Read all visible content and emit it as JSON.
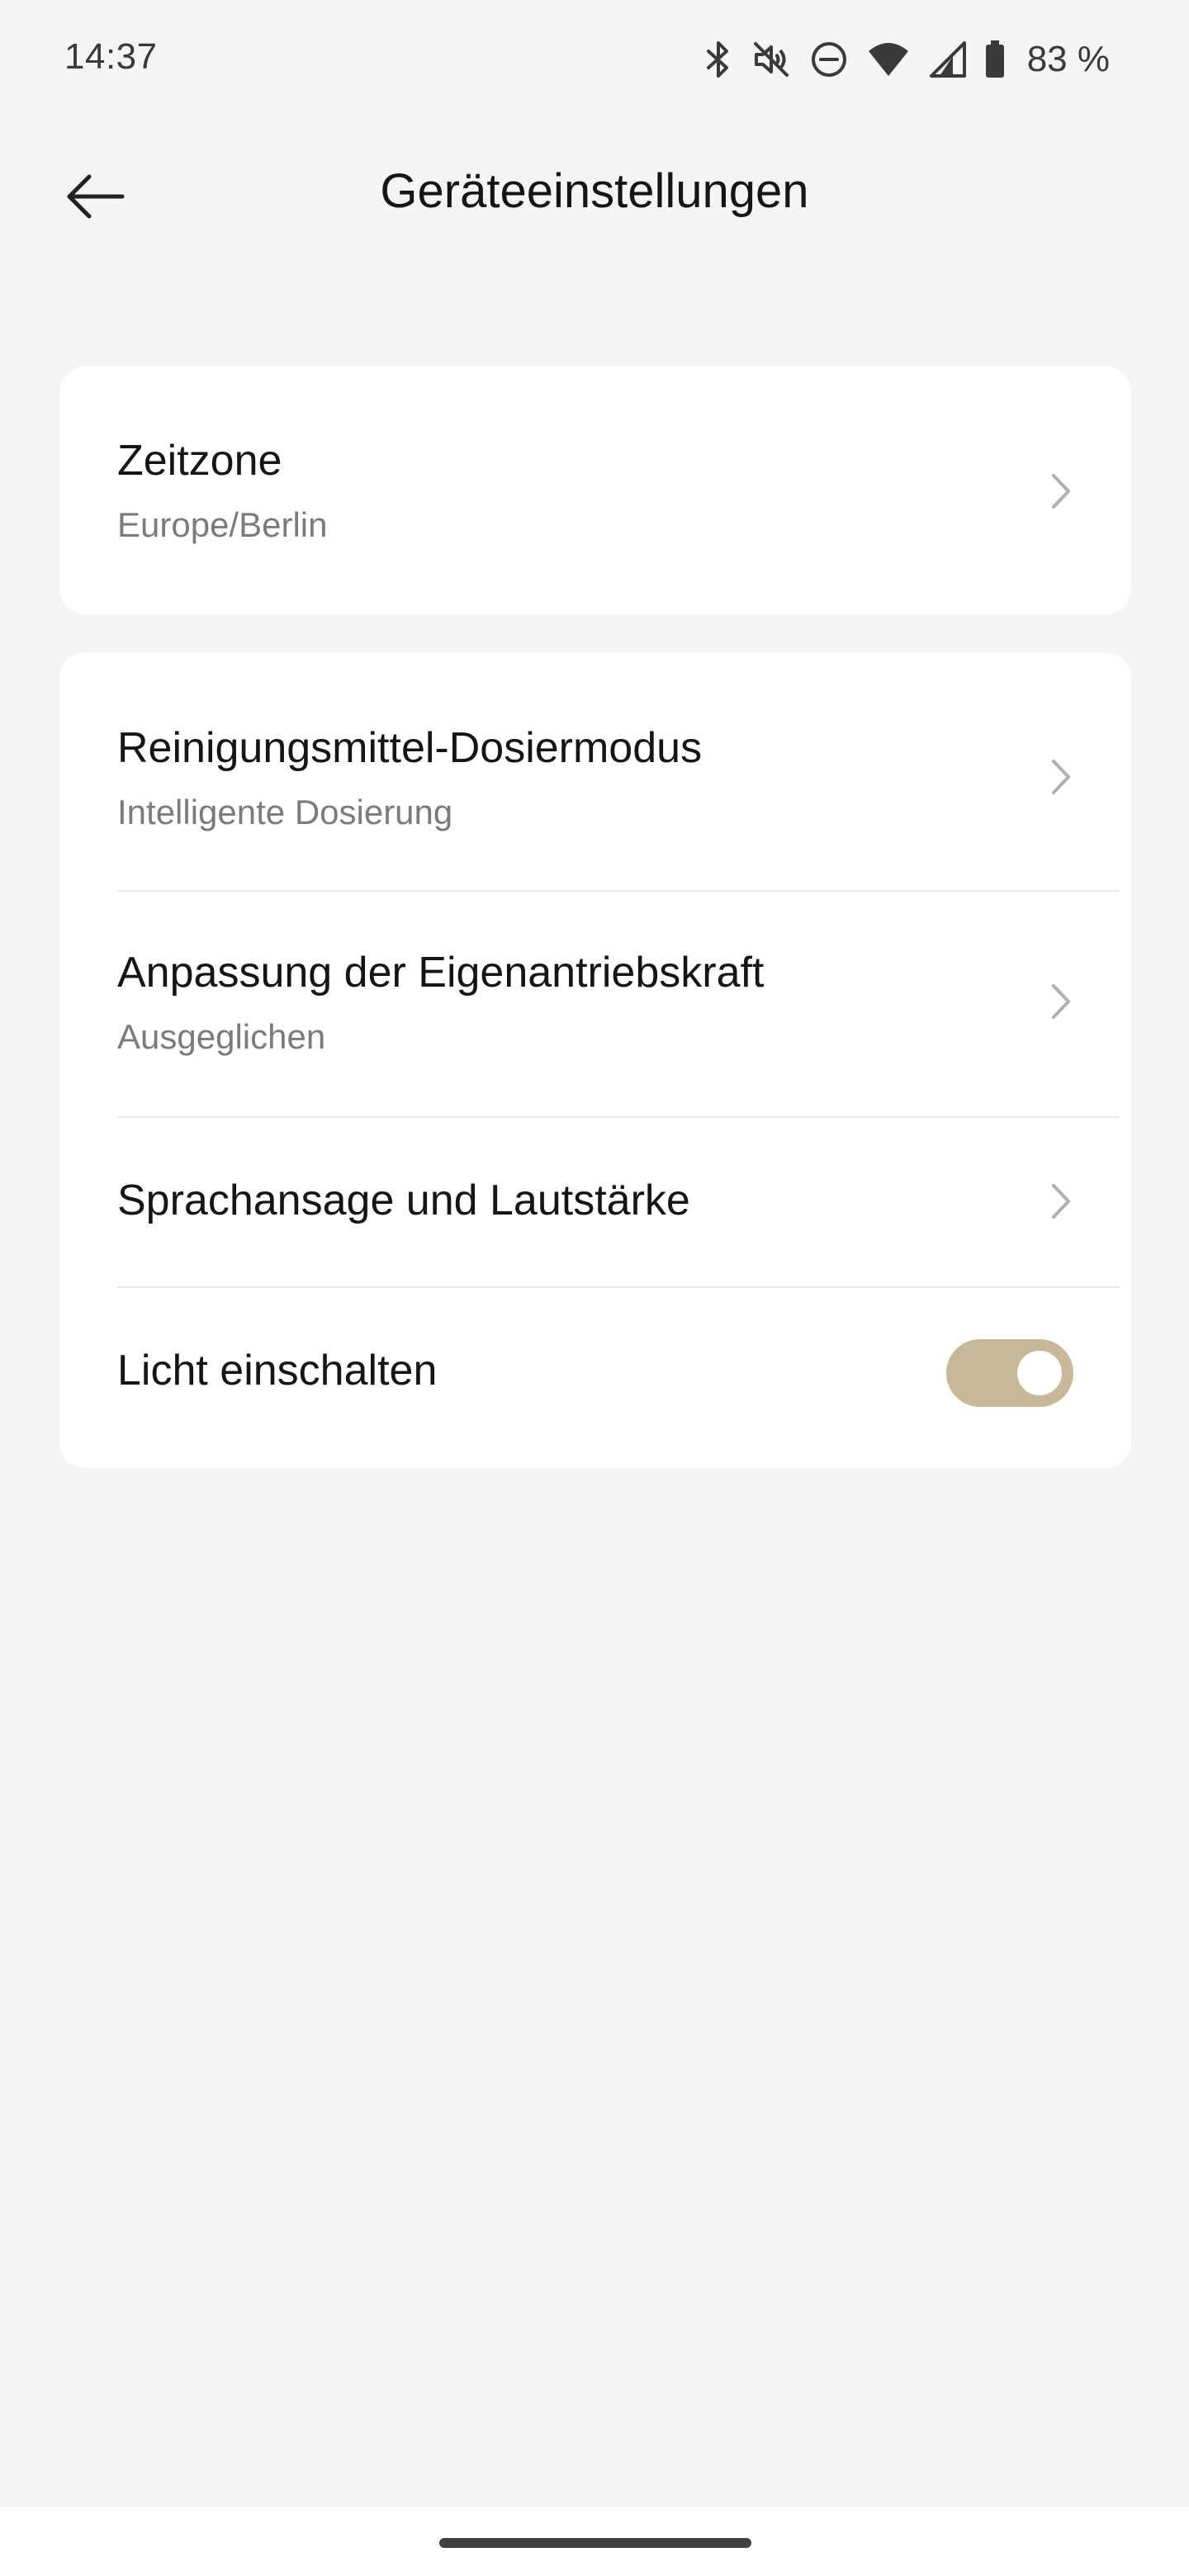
{
  "status_bar": {
    "time": "14:37",
    "battery_text": "83 %",
    "icons": [
      "bluetooth-icon",
      "mute-icon",
      "do-not-disturb-icon",
      "wifi-icon",
      "cell-signal-icon",
      "battery-icon"
    ]
  },
  "header": {
    "title": "Geräteeinstellungen",
    "back_icon": "arrow-left-icon"
  },
  "settings": {
    "timezone": {
      "title": "Zeitzone",
      "value": "Europe/Berlin"
    },
    "detergent_mode": {
      "title": "Reinigungsmittel-Dosiermodus",
      "value": "Intelligente Dosierung"
    },
    "self_drive": {
      "title": "Anpassung der Eigenantriebskraft",
      "value": "Ausgeglichen"
    },
    "voice": {
      "title": "Sprachansage und Lautstärke"
    },
    "light": {
      "title": "Licht einschalten",
      "enabled": true
    }
  },
  "colors": {
    "background": "#f5f5f5",
    "card": "#ffffff",
    "toggle_on": "#c8b89a",
    "chevron": "#b0b0b0"
  }
}
